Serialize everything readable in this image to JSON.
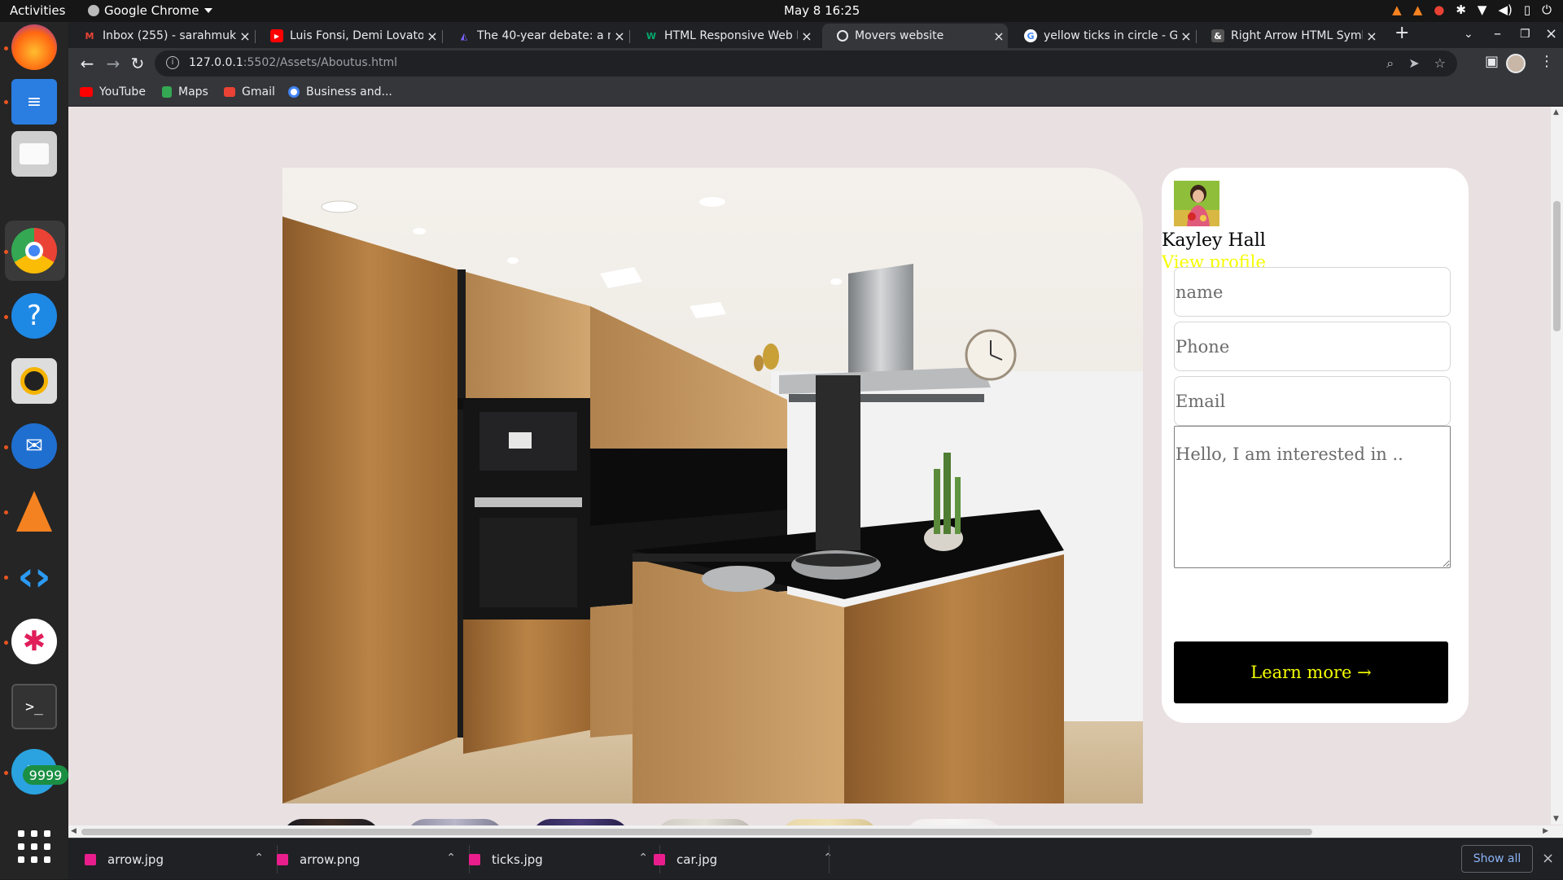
{
  "system": {
    "activities": "Activities",
    "app_name": "Google Chrome",
    "clock": "May 8  16:25"
  },
  "tabs": [
    {
      "title": "Inbox (255) - sarahmuku",
      "favicon": "gmail-icon"
    },
    {
      "title": "Luis Fonsi, Demi Lovato",
      "favicon": "youtube-icon"
    },
    {
      "title": "The 40-year debate: a me",
      "favicon": "article-icon"
    },
    {
      "title": "HTML Responsive Web D",
      "favicon": "w3-icon"
    },
    {
      "title": "Movers website",
      "favicon": "globe-icon",
      "active": true
    },
    {
      "title": "yellow ticks in circle - Go",
      "favicon": "google-icon"
    },
    {
      "title": "Right Arrow HTML Symb",
      "favicon": "ampersand-icon"
    }
  ],
  "address": {
    "host": "127.0.0.1",
    "path": ":5502/Assets/Aboutus.html"
  },
  "bookmarks": [
    {
      "label": "YouTube",
      "icon": "youtube-icon",
      "color": "#ff0000"
    },
    {
      "label": "Maps",
      "icon": "maps-icon",
      "color": "#34a853"
    },
    {
      "label": "Gmail",
      "icon": "gmail-icon",
      "color": "#ea4335"
    },
    {
      "label": "Business and...",
      "icon": "google-icon",
      "color": "#4285f4"
    }
  ],
  "card": {
    "agent_name": "Kayley Hall",
    "view_profile": "View profile",
    "name_placeholder": "name",
    "phone_placeholder": "Phone",
    "email_placeholder": "Email",
    "message_placeholder": "Hello, I am interested in ..",
    "submit_label": "Learn more →"
  },
  "dock": {
    "telegram_badge": "9999"
  },
  "downloads": [
    {
      "name": "arrow.jpg"
    },
    {
      "name": "arrow.png"
    },
    {
      "name": "ticks.jpg"
    },
    {
      "name": "car.jpg"
    }
  ],
  "downloads_show_all": "Show all",
  "colors": {
    "page_bg": "#e9e0e2",
    "accent_yellow": "#f6ff00",
    "button_bg": "#000000"
  }
}
